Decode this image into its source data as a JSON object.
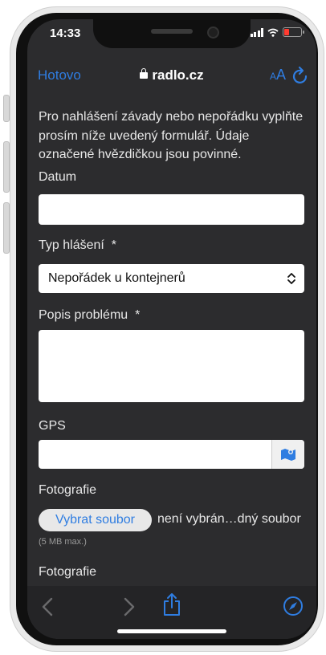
{
  "status_bar": {
    "time": "14:33"
  },
  "browser": {
    "done_label": "Hotovo",
    "domain": "radlo.cz",
    "text_size_small": "A",
    "text_size_large": "A"
  },
  "form": {
    "intro": "Pro nahlášení závady nebo nepořádku vyplňte prosím níže uvedený formulář. Údaje označené hvězdičkou jsou povinné.",
    "date_label": "Datum",
    "type_label": "Typ hlášení  *",
    "type_selected": "Nepořádek u kontejnerů",
    "description_label": "Popis problému  *",
    "gps_label": "GPS",
    "photo_label_1": "Fotografie",
    "file_button": "Vybrat soubor",
    "file_status": "není vybrán…dný soubor",
    "file_limit": "(5 MB max.)",
    "photo_label_2": "Fotografie"
  },
  "colors": {
    "accent": "#2f7de1",
    "background": "#2c2c2e",
    "battery": "#ff3b30"
  },
  "icons": [
    "lock-icon",
    "reload-icon",
    "map-icon",
    "chevron-updown-icon",
    "back-icon",
    "forward-icon",
    "share-icon",
    "compass-icon"
  ]
}
